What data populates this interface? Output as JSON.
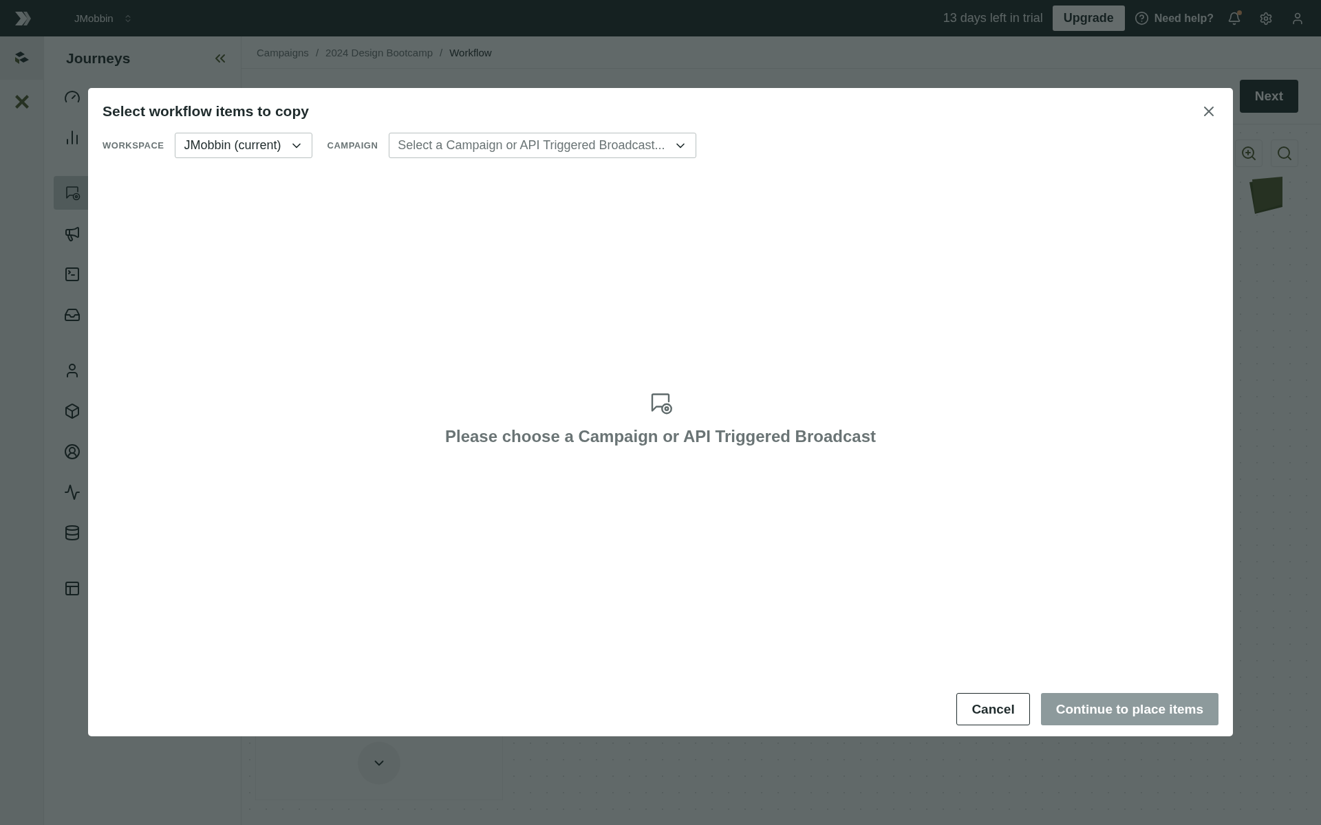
{
  "topbar": {
    "workspace": "JMobbin",
    "trial": "13 days left in trial",
    "upgrade": "Upgrade",
    "help": "Need help?",
    "notification": true
  },
  "sidebar": {
    "title": "Journeys",
    "groups": [
      {
        "items": [
          {
            "selected": false
          },
          {
            "selected": false
          }
        ]
      },
      {
        "items": [
          {
            "selected": true
          },
          {
            "selected": false
          },
          {
            "selected": false
          },
          {
            "selected": false
          }
        ]
      },
      {
        "items": [
          {
            "selected": false
          },
          {
            "selected": false
          },
          {
            "selected": false
          },
          {
            "selected": false
          },
          {
            "selected": false
          }
        ]
      },
      {
        "items": [
          {
            "selected": false
          }
        ]
      }
    ]
  },
  "breadcrumb": {
    "separator": "/",
    "items": [
      {
        "label": "Campaigns",
        "current": false
      },
      {
        "label": "2024 Design Bootcamp",
        "current": false
      },
      {
        "label": "Workflow",
        "current": true
      }
    ]
  },
  "toolbar": {
    "next": "Next"
  },
  "dialog": {
    "title": "Select workflow items to copy",
    "filters": [
      {
        "label": "WORKSPACE",
        "value": "JMobbin (current)"
      },
      {
        "label": "CAMPAIGN",
        "placeholder": "Select a Campaign or API Triggered Broadcast..."
      }
    ],
    "empty_message": "Please choose a Campaign or API Triggered Broadcast",
    "buttons": [
      {
        "label": "Cancel",
        "disabled": false,
        "kind": "secondary"
      },
      {
        "label": "Continue to place items",
        "disabled": true,
        "kind": "primary"
      }
    ]
  }
}
